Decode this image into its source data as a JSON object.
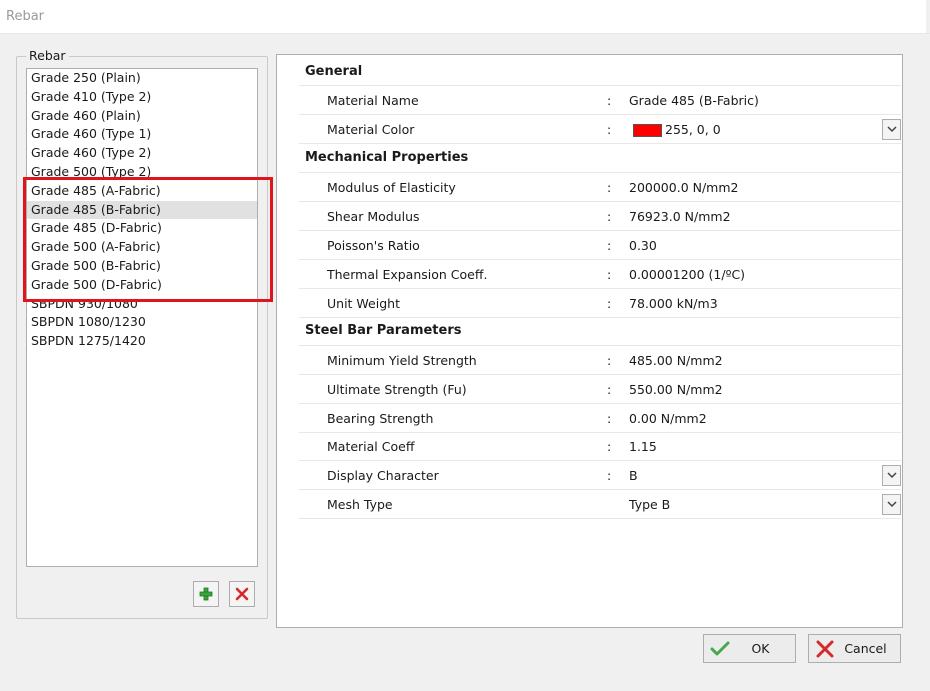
{
  "window": {
    "title": "Rebar"
  },
  "group": {
    "legend": "Rebar"
  },
  "list": {
    "items": [
      "Grade 250 (Plain)",
      "Grade 410 (Type 2)",
      "Grade 460 (Plain)",
      "Grade 460 (Type 1)",
      "Grade 460 (Type 2)",
      "Grade 500 (Type 2)",
      "Grade 485 (A-Fabric)",
      "Grade 485 (B-Fabric)",
      "Grade 485 (D-Fabric)",
      "Grade 500 (A-Fabric)",
      "Grade 500 (B-Fabric)",
      "Grade 500 (D-Fabric)",
      "SBPDN 930/1080",
      "SBPDN 1080/1230",
      "SBPDN 1275/1420"
    ],
    "selected": "Grade 485 (B-Fabric)",
    "highlight_color": "#e0141b"
  },
  "props": {
    "general": {
      "title": "General",
      "material_name_label": "Material Name",
      "material_name_value": "Grade 485 (B-Fabric)",
      "material_color_label": "Material Color",
      "material_color_value": "255, 0, 0",
      "material_color_hex": "#ff0000"
    },
    "mechanical": {
      "title": "Mechanical Properties",
      "elasticity_label": "Modulus of Elasticity",
      "elasticity_value": "200000.0  N/mm2",
      "shear_label": "Shear Modulus",
      "shear_value": "76923.0  N/mm2",
      "poisson_label": "Poisson's Ratio",
      "poisson_value": "0.30",
      "thermal_label": "Thermal Expansion Coeff.",
      "thermal_value": "0.00001200  (1/ºC)",
      "unit_weight_label": "Unit Weight",
      "unit_weight_value": "78.000  kN/m3"
    },
    "steel": {
      "title": "Steel Bar Parameters",
      "yield_label": "Minimum Yield Strength",
      "yield_value": "485.00  N/mm2",
      "ultimate_label": "Ultimate Strength (Fu)",
      "ultimate_value": "550.00  N/mm2",
      "bearing_label": "Bearing Strength",
      "bearing_value": "0.00  N/mm2",
      "coeff_label": "Material Coeff",
      "coeff_value": "1.15",
      "display_char_label": "Display Character",
      "display_char_value": "B",
      "mesh_type_label": "Mesh Type",
      "mesh_type_value": "Type B"
    },
    "colon": ":"
  },
  "buttons": {
    "ok": "OK",
    "cancel": "Cancel"
  },
  "icons": {
    "add": "plus-icon",
    "delete": "x-icon",
    "ok": "checkmark-icon",
    "cancel": "x-icon",
    "dropdown": "chevron-down-icon"
  }
}
